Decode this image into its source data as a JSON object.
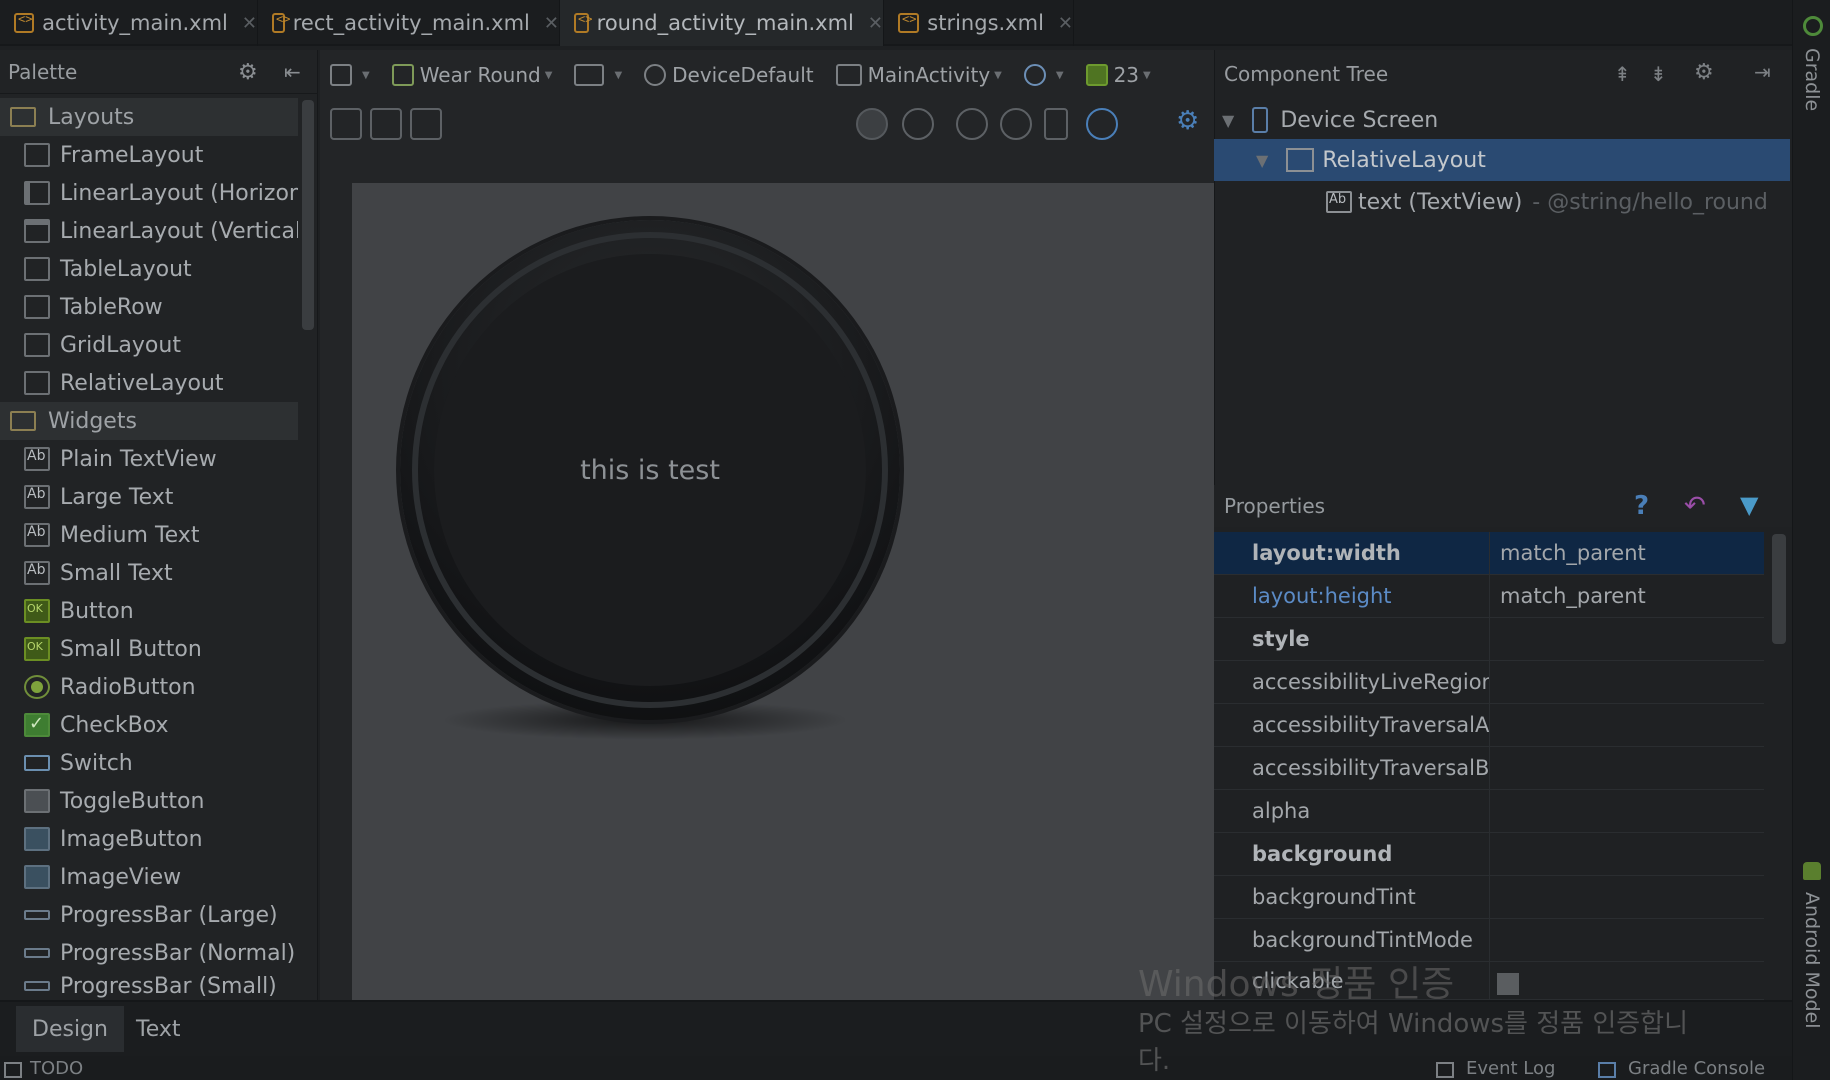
{
  "tabs": [
    {
      "label": "activity_main.xml",
      "active": false
    },
    {
      "label": "rect_activity_main.xml",
      "active": false
    },
    {
      "label": "round_activity_main.xml",
      "active": true
    },
    {
      "label": "strings.xml",
      "active": false
    }
  ],
  "palette": {
    "title": "Palette",
    "groups": [
      {
        "label": "Layouts",
        "items": [
          "FrameLayout",
          "LinearLayout (Horizontal)",
          "LinearLayout (Vertical)",
          "TableLayout",
          "TableRow",
          "GridLayout",
          "RelativeLayout"
        ]
      },
      {
        "label": "Widgets",
        "items": [
          "Plain TextView",
          "Large Text",
          "Medium Text",
          "Small Text",
          "Button",
          "Small Button",
          "RadioButton",
          "CheckBox",
          "Switch",
          "ToggleButton",
          "ImageButton",
          "ImageView",
          "ProgressBar (Large)",
          "ProgressBar (Normal)",
          "ProgressBar (Small)"
        ]
      }
    ]
  },
  "toolbar": {
    "device": "Wear Round",
    "theme": "DeviceDefault",
    "activity": "MainActivity",
    "api": "23"
  },
  "canvas": {
    "text": "this is test"
  },
  "component_tree": {
    "title": "Component Tree",
    "device": "Device Screen",
    "layout": "RelativeLayout",
    "text_item": "text (TextView)",
    "text_hint": "- @string/hello_round"
  },
  "properties": {
    "title": "Properties",
    "rows": [
      {
        "name": "layout:width",
        "value": "match_parent"
      },
      {
        "name": "layout:height",
        "value": "match_parent"
      },
      {
        "name": "style",
        "value": ""
      },
      {
        "name": "accessibilityLiveRegion",
        "value": ""
      },
      {
        "name": "accessibilityTraversalAfter",
        "value": ""
      },
      {
        "name": "accessibilityTraversalBefore",
        "value": ""
      },
      {
        "name": "alpha",
        "value": ""
      },
      {
        "name": "background",
        "value": ""
      },
      {
        "name": "backgroundTint",
        "value": ""
      },
      {
        "name": "backgroundTintMode",
        "value": ""
      },
      {
        "name": "clickable",
        "value": ""
      }
    ]
  },
  "bottom_tabs": [
    "Design",
    "Text"
  ],
  "status": {
    "todo": "TODO",
    "event_log": "Event Log",
    "gradle_console": "Gradle Console"
  },
  "side_tabs": {
    "gradle": "Gradle",
    "android_model": "Android Model"
  },
  "watermark": {
    "line1": "Windows 정품 인증",
    "line2": "PC 설정으로 이동하여 Windows를 정품 인증합니",
    "line3": "다."
  },
  "colors": {
    "selection": "#2a4a72",
    "selected_property": "#0f2744",
    "accent_link": "#5b8bc6"
  }
}
